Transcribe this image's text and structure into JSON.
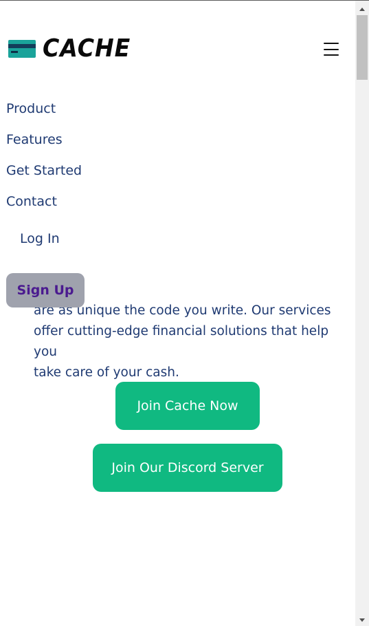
{
  "header": {
    "brand": "CACHE",
    "menu_icon": "hamburger-icon",
    "logo_icon": "credit-card-icon"
  },
  "nav": {
    "items": [
      {
        "label": "Product"
      },
      {
        "label": "Features"
      },
      {
        "label": "Get Started"
      },
      {
        "label": "Contact"
      }
    ],
    "login_label": "Log In",
    "signup_label": "Sign Up"
  },
  "hero": {
    "text_line_clipped": "are as unique the code you write. Our services",
    "text_line_2": "offer cutting-edge financial solutions that help you",
    "text_line_3": "take care of your cash.",
    "join_label": "Join Cache Now",
    "discord_label": "Join Our Discord Server"
  },
  "colors": {
    "accent_green": "#10b981",
    "text_navy": "#1f3a72",
    "signup_bg": "#9fa2ad",
    "signup_text": "#4a1a8f"
  }
}
